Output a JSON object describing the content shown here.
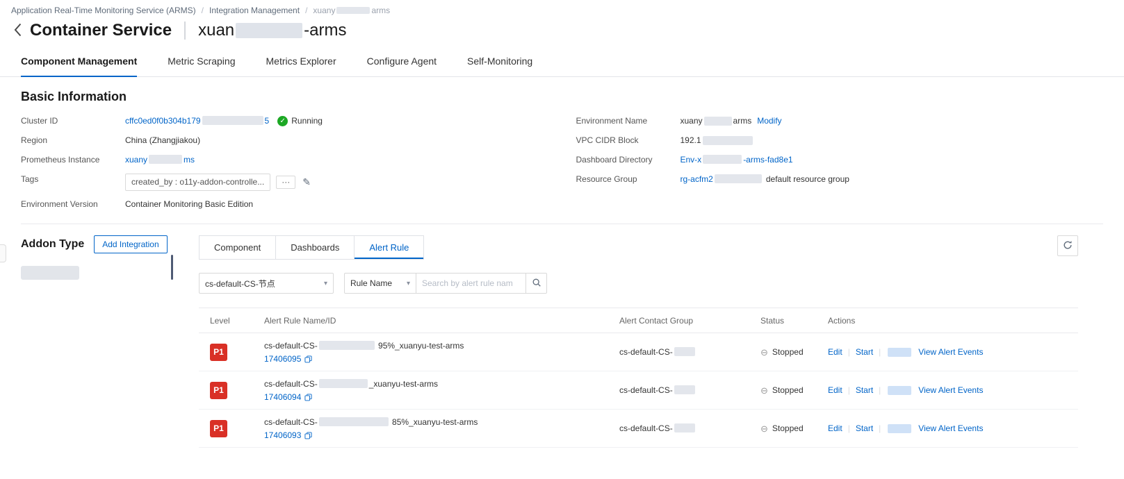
{
  "colors": {
    "link": "#0064c8",
    "badge_red": "#d93026",
    "running_green": "#1ca824"
  },
  "icons": {
    "chevron_down": "▾",
    "stopped": "⊖",
    "running_check": "✓",
    "edit_pencil": "✎",
    "more": "···"
  },
  "breadcrumb": {
    "separator": "/",
    "items": [
      "Application Real-Time Monitoring Service (ARMS)",
      "Integration Management"
    ],
    "current_prefix": "xuany",
    "current_suffix": "arms"
  },
  "header": {
    "title": "Container Service",
    "instance_prefix": "xuan",
    "instance_suffix": "-arms"
  },
  "tabs": [
    "Component Management",
    "Metric Scraping",
    "Metrics Explorer",
    "Configure Agent",
    "Self-Monitoring"
  ],
  "basic_info": {
    "title": "Basic Information",
    "left": {
      "cluster_id_label": "Cluster ID",
      "cluster_id_prefix": "cffc0ed0f0b304b179",
      "cluster_id_suffix": "5",
      "cluster_status": "Running",
      "region_label": "Region",
      "region": "China (Zhangjiakou)",
      "prometheus_label": "Prometheus Instance",
      "prometheus_prefix": "xuany",
      "prometheus_suffix": "ms",
      "tags_label": "Tags",
      "tag": "created_by : o11y-addon-controlle...",
      "env_version_label": "Environment Version",
      "env_version": "Container Monitoring Basic Edition"
    },
    "right": {
      "env_name_label": "Environment Name",
      "env_name_prefix": "xuany",
      "env_name_suffix": "arms",
      "modify": "Modify",
      "vpc_label": "VPC CIDR Block",
      "vpc_prefix": "192.1",
      "dashboard_label": "Dashboard Directory",
      "dashboard_prefix": "Env-x",
      "dashboard_suffix": "-arms-fad8e1",
      "resource_label": "Resource Group",
      "resource_prefix": "rg-acfm2",
      "resource_plain": "default resource group"
    }
  },
  "addon": {
    "title": "Addon Type",
    "add_button": "Add Integration"
  },
  "panel": {
    "tabs": [
      "Component",
      "Dashboards",
      "Alert Rule"
    ],
    "filters": {
      "scope_select": "cs-default-CS-节点",
      "rule_select": "Rule Name",
      "search_placeholder": "Search by alert rule nam"
    },
    "table": {
      "headers": [
        "Level",
        "Alert Rule Name/ID",
        "Alert Contact Group",
        "Status",
        "Actions"
      ],
      "actions": {
        "edit": "Edit",
        "start": "Start",
        "view": "View Alert Events",
        "sep": "|"
      },
      "rows": [
        {
          "level": "P1",
          "name_prefix": "cs-default-CS-",
          "name_suffix": " 95%_xuanyu-test-arms",
          "id": "17406095",
          "contact_prefix": "cs-default-CS-",
          "status": "Stopped"
        },
        {
          "level": "P1",
          "name_prefix": "cs-default-CS-",
          "name_suffix": "_xuanyu-test-arms",
          "id": "17406094",
          "contact_prefix": "cs-default-CS-",
          "status": "Stopped"
        },
        {
          "level": "P1",
          "name_prefix": "cs-default-CS-",
          "name_suffix": " 85%_xuanyu-test-arms",
          "id": "17406093",
          "contact_prefix": "cs-default-CS-",
          "status": "Stopped"
        }
      ]
    }
  }
}
